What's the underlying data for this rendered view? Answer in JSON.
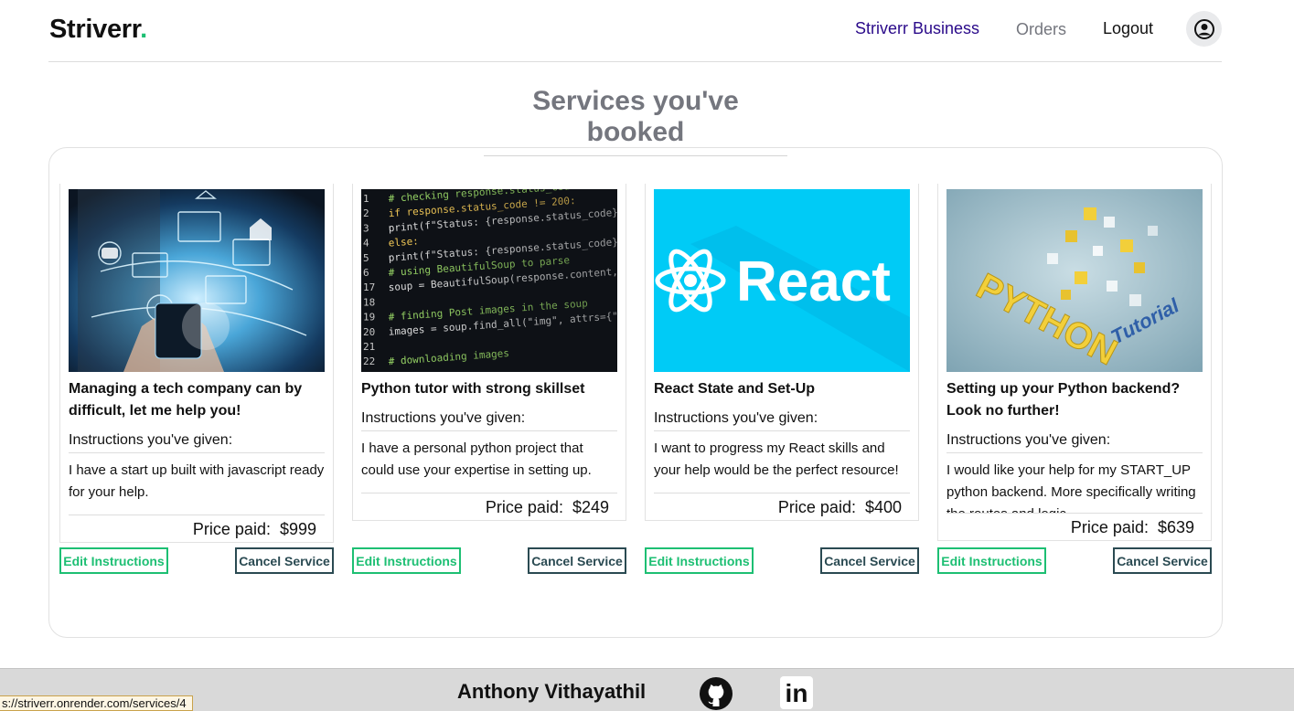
{
  "header": {
    "logo_text": "Striverr",
    "logo_dot": ".",
    "nav": {
      "business": "Striverr Business",
      "orders": "Orders",
      "logout": "Logout"
    },
    "icons": {
      "avatar": "user-circle-icon"
    }
  },
  "page_title": "Services you've booked",
  "labels": {
    "instructions": "Instructions you've given:",
    "price_paid": "Price paid:",
    "edit": "Edit Instructions",
    "cancel": "Cancel Service"
  },
  "cards": [
    {
      "title": "Managing a tech company can by difficult, let me help you!",
      "instructions": "I have a start up built with javascript ready for your help.",
      "price": "$999",
      "image": "tech-network-image"
    },
    {
      "title": "Python tutor with strong skillset",
      "instructions": "I have a personal python project that could use your expertise in setting up.",
      "price": "$249",
      "image": "python-code-image"
    },
    {
      "title": "React State and Set-Up",
      "instructions": "I want to progress my React skills and your help would be the perfect resource!",
      "price": "$400",
      "image": "react-logo-image"
    },
    {
      "title": "Setting up your Python backend? Look no further!",
      "instructions": "I would like your help for my START_UP python backend. More specifically writing the routes and logic.",
      "price": "$639",
      "image": "python-tutorial-image"
    }
  ],
  "images_text": {
    "react": "React",
    "python": "PYTHON",
    "tutorial": "Tutorial",
    "code_lines": [
      {
        "n": "1",
        "t": "# checking response.status_code"
      },
      {
        "n": "2",
        "t": "if response.status_code != 200:"
      },
      {
        "n": "3",
        "t": "    print(f\"Status: {response.status_code}\")"
      },
      {
        "n": "4",
        "t": "else:"
      },
      {
        "n": "5",
        "t": "    print(f\"Status: {response.status_code}\")"
      },
      {
        "n": "6",
        "t": "# using BeautifulSoup to parse"
      },
      {
        "n": "17",
        "t": "soup = BeautifulSoup(response.content, \"html.parser\")"
      },
      {
        "n": "18",
        "t": ""
      },
      {
        "n": "19",
        "t": "# finding Post images in the soup"
      },
      {
        "n": "20",
        "t": "images = soup.find_all(\"img\", attrs={\"alt\": \"Post image\"})"
      },
      {
        "n": "21",
        "t": ""
      },
      {
        "n": "22",
        "t": "# downloading images"
      }
    ]
  },
  "footer": {
    "name": "Anthony Vithayathil",
    "icons": {
      "github": "github-icon",
      "linkedin": "linkedin-icon"
    },
    "linkedin_text": "in"
  },
  "status_bar": {
    "url": "s://striverr.onrender.com/services/4"
  },
  "colors": {
    "brand_green": "#1dbf73",
    "business": "#2a0a8a",
    "cancel": "#2a4a52"
  }
}
